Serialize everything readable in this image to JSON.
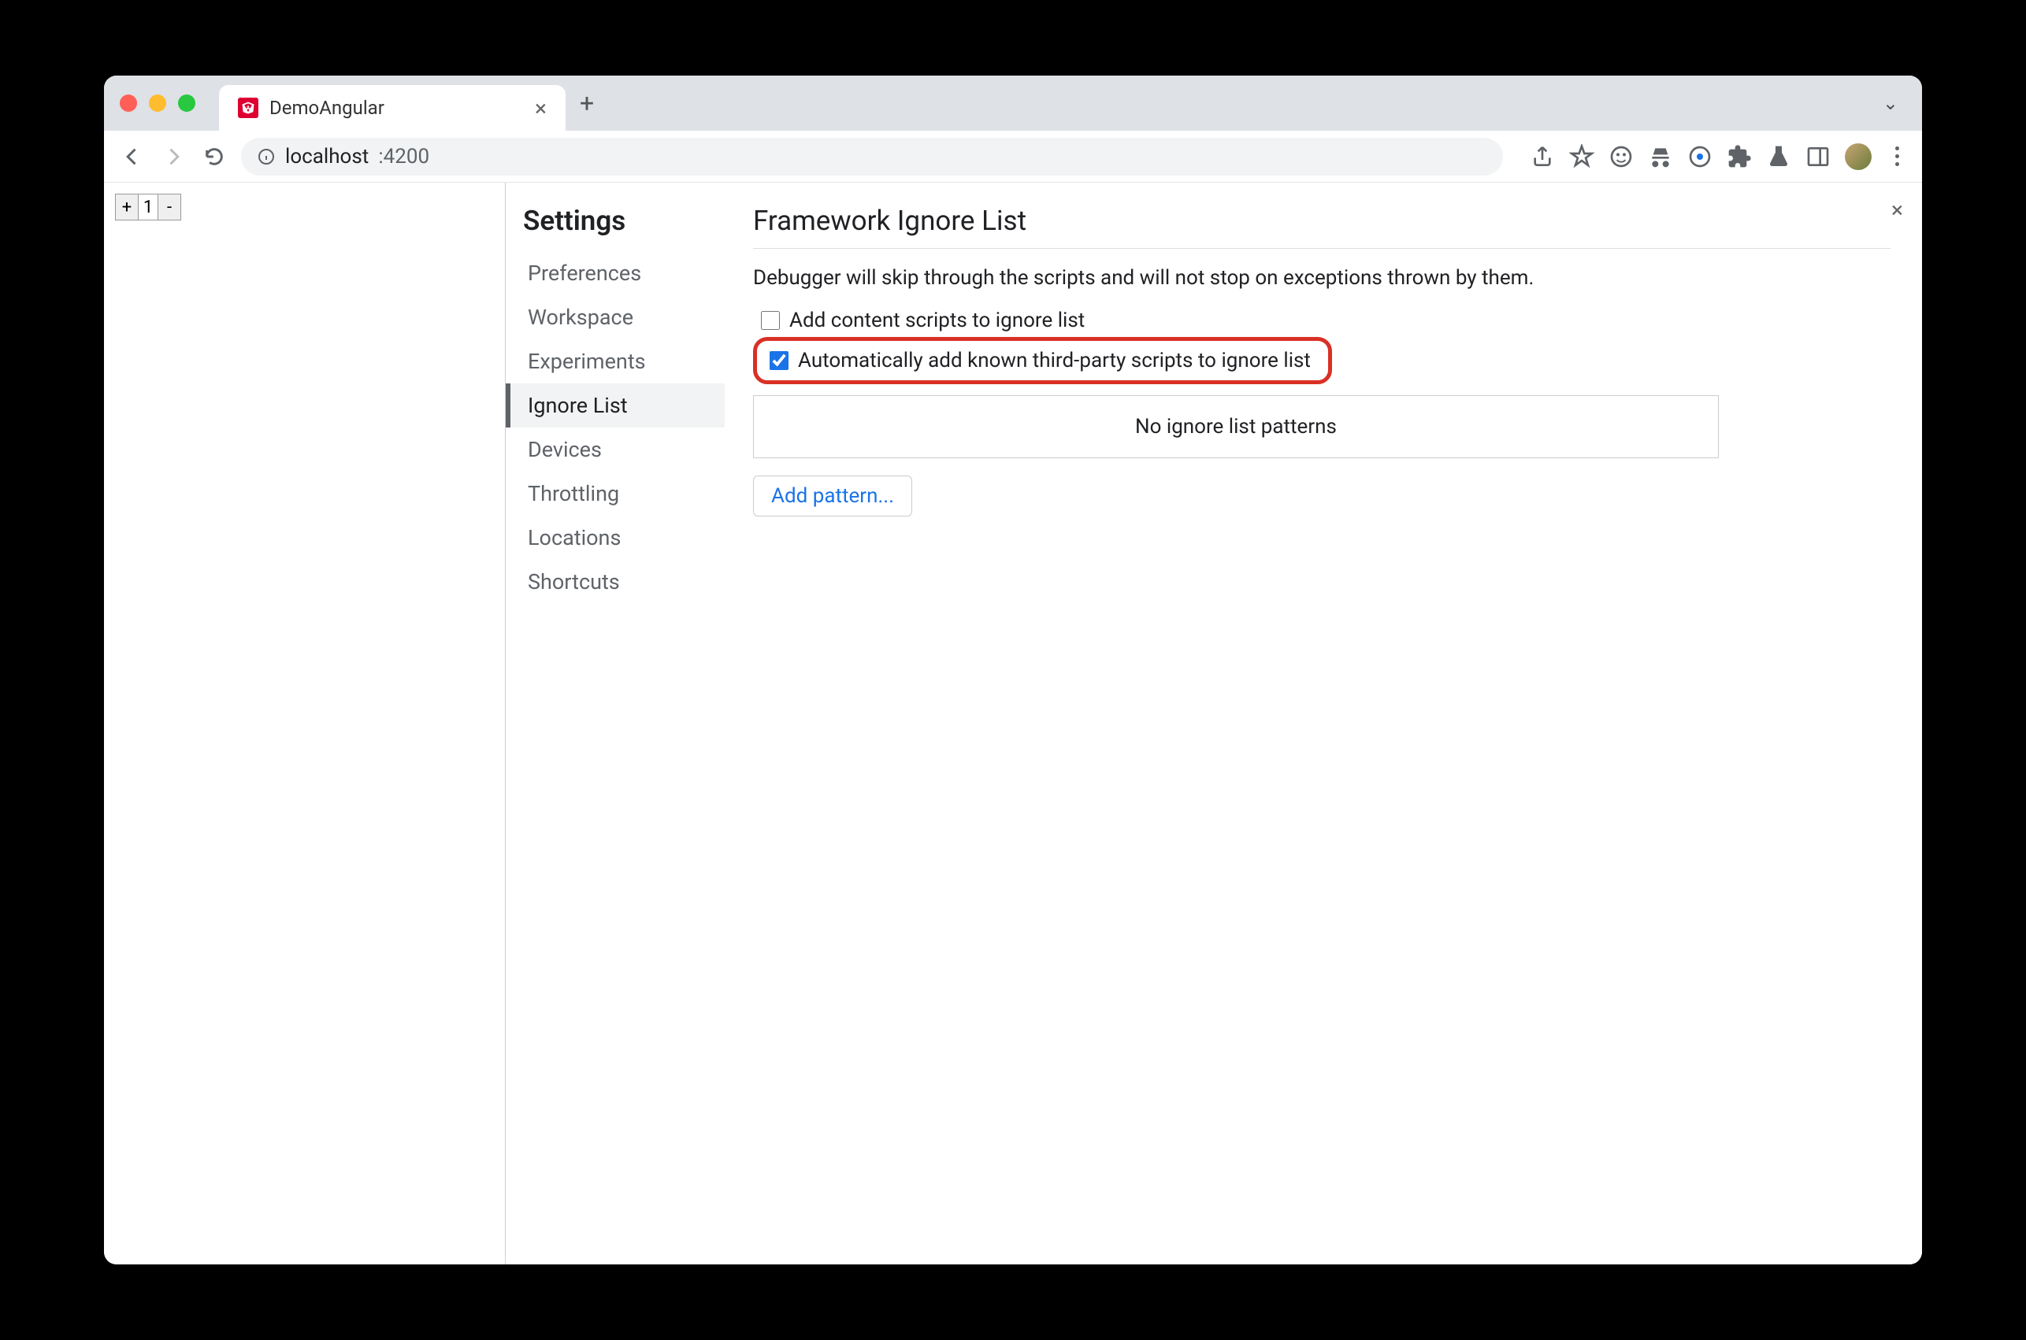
{
  "tab": {
    "title": "DemoAngular"
  },
  "url": {
    "host": "localhost",
    "port": ":4200"
  },
  "counter": {
    "plus": "+",
    "value": "1",
    "minus": "-"
  },
  "settings": {
    "title": "Settings",
    "items": [
      "Preferences",
      "Workspace",
      "Experiments",
      "Ignore List",
      "Devices",
      "Throttling",
      "Locations",
      "Shortcuts"
    ],
    "activeIndex": 3
  },
  "panel": {
    "heading": "Framework Ignore List",
    "description": "Debugger will skip through the scripts and will not stop on exceptions thrown by them.",
    "chk1": "Add content scripts to ignore list",
    "chk2": "Automatically add known third-party scripts to ignore list",
    "empty": "No ignore list patterns",
    "addPattern": "Add pattern..."
  }
}
